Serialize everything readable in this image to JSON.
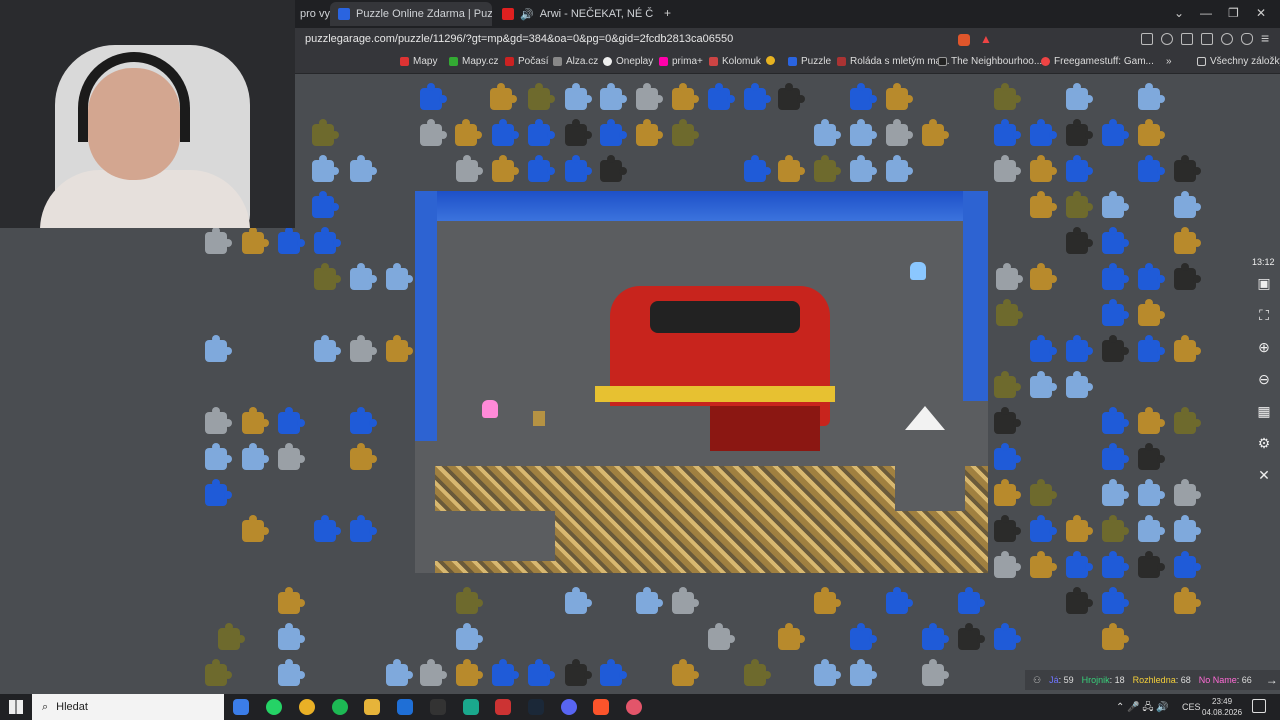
{
  "tabs": [
    {
      "label": "pro vyle"
    },
    {
      "label": "Puzzle Online Zdarma | Puzzle G"
    },
    {
      "label": "Arwi - NEČEKAT, NÉ ČEKAT! - You"
    }
  ],
  "address": {
    "url": "puzzlegarage.com/puzzle/11296/?gt=mp&gd=384&oa=0&pg=0&gid=2fcdb2813ca06550"
  },
  "bookmarks": [
    {
      "label": "Mapy"
    },
    {
      "label": "Mapy.cz"
    },
    {
      "label": "Počasí"
    },
    {
      "label": "Alza.cz"
    },
    {
      "label": "Oneplay"
    },
    {
      "label": "prima+"
    },
    {
      "label": "Kolomuk"
    },
    {
      "label": "Puzzle"
    },
    {
      "label": "Roláda s mletým ma..."
    },
    {
      "label": "The Neighbourhoo..."
    },
    {
      "label": "Freegamestuff: Gam..."
    }
  ],
  "bookmarks_all": "Všechny záložky",
  "game": {
    "timer": "13:12",
    "scores": [
      {
        "name": "Já",
        "value": "59",
        "color": "#6f74ff"
      },
      {
        "name": "Hrojnik",
        "value": "18",
        "color": "#37d07a"
      },
      {
        "name": "Rozhledna",
        "value": "68",
        "color": "#f4cf3a"
      },
      {
        "name": "No Name",
        "value": "66",
        "color": "#ff6bd6"
      }
    ]
  },
  "taskbar": {
    "search": "Hledat",
    "lang": "CES",
    "time": "23:49",
    "date": "04.08.2026"
  },
  "colors": {
    "accent": "#1f5bd8",
    "chrome": "#35363a",
    "bg": "#4a4d51"
  }
}
